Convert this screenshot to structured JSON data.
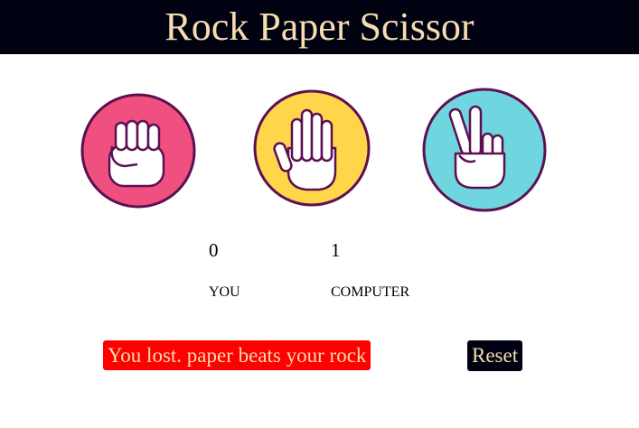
{
  "app": {
    "title": "Rock Paper Scissor"
  },
  "choices": [
    {
      "name": "rock",
      "icon": "fist-icon",
      "color": "#f0507f"
    },
    {
      "name": "paper",
      "icon": "open-hand-icon",
      "color": "#ffd54a"
    },
    {
      "name": "scissor",
      "icon": "peace-sign-icon",
      "color": "#6fd6df"
    }
  ],
  "ring_color": "#5c1052",
  "score": {
    "user": {
      "value": "0",
      "label": "YOU"
    },
    "computer": {
      "value": "1",
      "label": "COMPUTER"
    }
  },
  "result": {
    "message": "You lost. paper beats your rock",
    "color": "#ff0000"
  },
  "controls": {
    "reset_label": "Reset"
  },
  "colors": {
    "header_bg": "#000212",
    "accent_text": "#f6dcb0"
  }
}
